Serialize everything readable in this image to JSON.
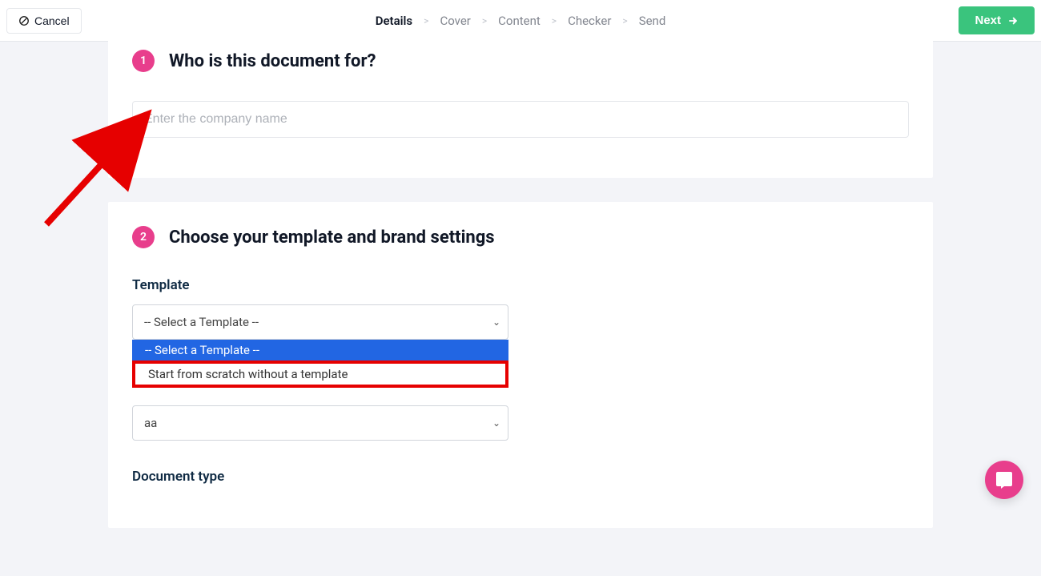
{
  "header": {
    "cancel_label": "Cancel",
    "next_label": "Next",
    "steps": [
      "Details",
      "Cover",
      "Content",
      "Checker",
      "Send"
    ]
  },
  "section1": {
    "badge": "1",
    "title": "Who is this document for?",
    "placeholder": "Enter the company name"
  },
  "section2": {
    "badge": "2",
    "title": "Choose your template and brand settings",
    "template_label": "Template",
    "template_value": "-- Select a Template --",
    "options": {
      "opt0": "-- Select a Template --",
      "opt1": "Start from scratch without a template"
    },
    "brand_value": "aa",
    "document_type_label": "Document type"
  }
}
